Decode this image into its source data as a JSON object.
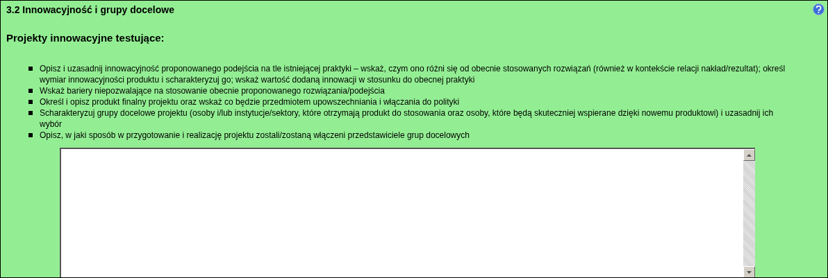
{
  "section": {
    "title": "3.2 Innowacyjność i grupy docelowe",
    "heading": "Projekty innowacyjne testujące:",
    "instructions": [
      "Opisz i uzasadnij innowacyjność proponowanego podejścia na tle istniejącej praktyki – wskaż, czym ono różni się od obecnie stosowanych rozwiązań (również w kontekście relacji nakład/rezultat); określ wymiar innowacyjności produktu i scharakteryzuj go; wskaż wartość dodaną innowacji w stosunku do obecnej praktyki",
      "Wskaż bariery niepozwalające na stosowanie obecnie proponowanego rozwiązania/podejścia",
      "Określ i opisz produkt finalny projektu oraz wskaż co będzie przedmiotem upowszechniania i włączania do polityki",
      "Scharakteryzuj grupy docelowe projektu (osoby i/lub instytucje/sektory, które otrzymają produkt do stosowania oraz osoby, które będą skuteczniej wspierane dzięki nowemu produktowi) i uzasadnij ich wybór",
      "Opisz, w jaki sposób w przygotowanie i realizację projektu zostali/zostaną włączeni przedstawiciele grup docelowych"
    ]
  }
}
